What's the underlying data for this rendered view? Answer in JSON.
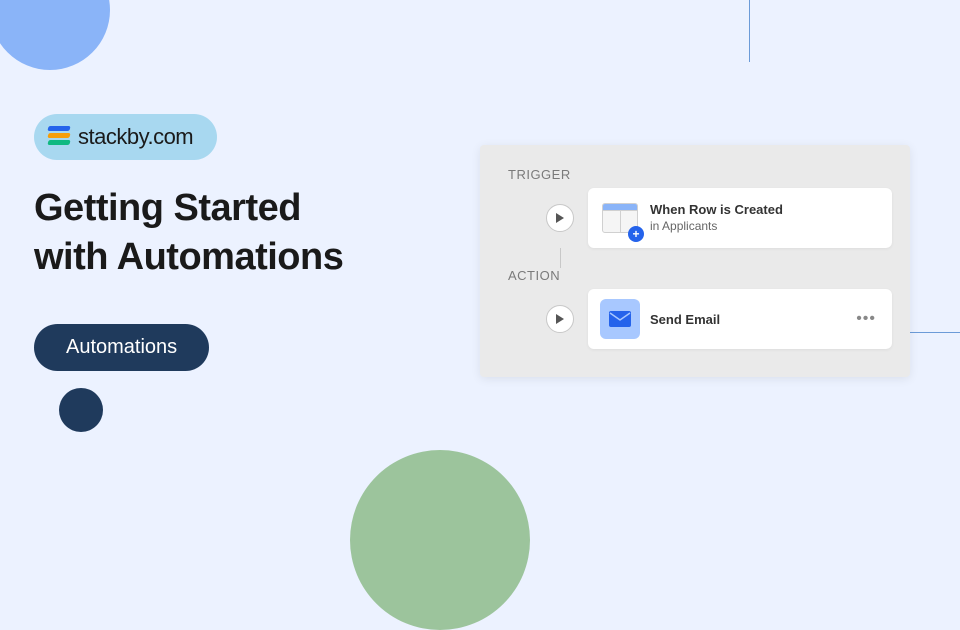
{
  "brand": {
    "name": "stackby",
    "suffix": ".com"
  },
  "title": "Getting Started\nwith Automations",
  "tag": "Automations",
  "panel": {
    "trigger_label": "TRIGGER",
    "action_label": "ACTION",
    "trigger": {
      "title": "When Row is Created",
      "subtitle": "in Applicants",
      "icon": "table-add-icon"
    },
    "action": {
      "title": "Send Email",
      "icon": "mail-icon"
    }
  }
}
